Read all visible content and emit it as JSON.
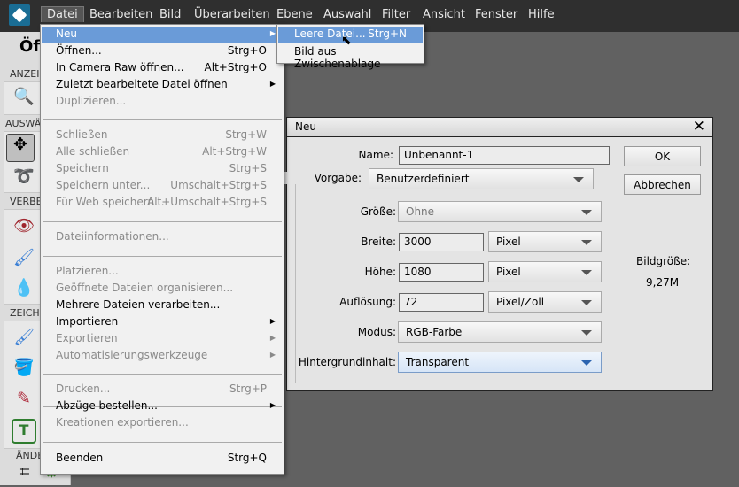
{
  "menubar": {
    "items": [
      "Datei",
      "Bearbeiten",
      "Bild",
      "Überarbeiten",
      "Ebene",
      "Auswahl",
      "Filter",
      "Ansicht",
      "Fenster",
      "Hilfe"
    ]
  },
  "header": {
    "title": "Öff"
  },
  "toolbar": {
    "sections": [
      "ANZEI",
      "AUSWÄ",
      "VERBE",
      "ZEICH",
      "ÄNDE"
    ]
  },
  "file_menu": {
    "items": [
      {
        "label": "Neu",
        "shortcut": "",
        "submenu": true,
        "enabled": true
      },
      {
        "label": "Öffnen...",
        "shortcut": "Strg+O",
        "enabled": true
      },
      {
        "label": "In Camera Raw öffnen...",
        "shortcut": "Alt+Strg+O",
        "enabled": true
      },
      {
        "label": "Zuletzt bearbeitete Datei öffnen",
        "shortcut": "",
        "submenu": true,
        "enabled": true
      },
      {
        "label": "Duplizieren...",
        "shortcut": "",
        "enabled": false
      },
      {
        "label": "Schließen",
        "shortcut": "Strg+W",
        "enabled": false
      },
      {
        "label": "Alle schließen",
        "shortcut": "Alt+Strg+W",
        "enabled": false
      },
      {
        "label": "Speichern",
        "shortcut": "Strg+S",
        "enabled": false
      },
      {
        "label": "Speichern unter...",
        "shortcut": "Umschalt+Strg+S",
        "enabled": false
      },
      {
        "label": "Für Web speichern...",
        "shortcut": "Alt+Umschalt+Strg+S",
        "enabled": false
      },
      {
        "label": "Dateiinformationen...",
        "shortcut": "",
        "enabled": false
      },
      {
        "label": "Platzieren...",
        "shortcut": "",
        "enabled": false
      },
      {
        "label": "Geöffnete Dateien organisieren...",
        "shortcut": "",
        "enabled": false
      },
      {
        "label": "Mehrere Dateien verarbeiten...",
        "shortcut": "",
        "enabled": true
      },
      {
        "label": "Importieren",
        "shortcut": "",
        "submenu": true,
        "enabled": true
      },
      {
        "label": "Exportieren",
        "shortcut": "",
        "submenu": true,
        "enabled": false
      },
      {
        "label": "Automatisierungswerkzeuge",
        "shortcut": "",
        "submenu": true,
        "enabled": false
      },
      {
        "label": "Drucken...",
        "shortcut": "Strg+P",
        "enabled": false
      },
      {
        "label": "Abzüge bestellen...",
        "shortcut": "",
        "submenu": true,
        "enabled": true
      },
      {
        "label": "Kreationen exportieren...",
        "shortcut": "",
        "enabled": false
      },
      {
        "label": "Beenden",
        "shortcut": "Strg+Q",
        "enabled": true
      }
    ]
  },
  "new_submenu": {
    "items": [
      {
        "label": "Leere Datei...",
        "shortcut": "Strg+N"
      },
      {
        "label": "Bild aus Zwischenablage",
        "shortcut": ""
      }
    ]
  },
  "dialog": {
    "title": "Neu",
    "name_label": "Name:",
    "name_value": "Unbenannt-1",
    "preset_label": "Vorgabe:",
    "preset_value": "Benutzerdefiniert",
    "size_label": "Größe:",
    "size_value": "Ohne",
    "width_label": "Breite:",
    "width_value": "3000",
    "width_unit": "Pixel",
    "height_label": "Höhe:",
    "height_value": "1080",
    "height_unit": "Pixel",
    "resolution_label": "Auflösung:",
    "resolution_value": "72",
    "resolution_unit": "Pixel/Zoll",
    "mode_label": "Modus:",
    "mode_value": "RGB-Farbe",
    "background_label": "Hintergrundinhalt:",
    "background_value": "Transparent",
    "ok": "OK",
    "cancel": "Abbrechen",
    "image_size_label": "Bildgröße:",
    "image_size_value": "9,27M"
  }
}
